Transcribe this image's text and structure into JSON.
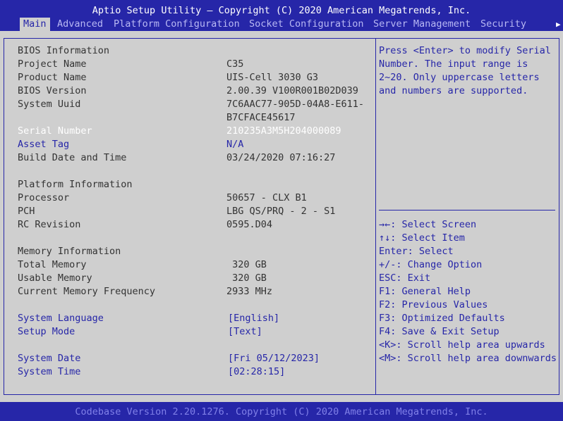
{
  "window": {
    "title": "Aptio Setup Utility – Copyright (C) 2020 American Megatrends, Inc."
  },
  "tabs": [
    {
      "label": "Main"
    },
    {
      "label": "Advanced"
    },
    {
      "label": "Platform Configuration"
    },
    {
      "label": "Socket Configuration"
    },
    {
      "label": "Server Management"
    },
    {
      "label": "Security"
    }
  ],
  "more_tabs_icon": "right-arrow-icon",
  "more_tabs_glyph": "▶",
  "bios": {
    "heading": "BIOS Information",
    "project_name_label": "Project Name",
    "project_name": "C35",
    "product_name_label": "Product Name",
    "product_name": "UIS-Cell 3030 G3",
    "bios_version_label": "BIOS Version",
    "bios_version": "2.00.39 V100R001B02D039",
    "uuid_label": "System Uuid",
    "uuid_line1": "7C6AAC77-905D-04A8-E611-",
    "uuid_line2": "B7CFACE45617",
    "serial_label": "Serial Number",
    "serial": "210235A3M5H204000089",
    "asset_label": "Asset Tag",
    "asset": "N/A",
    "build_label": "Build Date and Time",
    "build": "03/24/2020 07:16:27"
  },
  "platform": {
    "heading": "Platform Information",
    "processor_label": "Processor",
    "processor": "50657 - CLX B1",
    "pch_label": "PCH",
    "pch": "LBG QS/PRQ - 2 - S1",
    "rc_label": "RC Revision",
    "rc": "0595.D04"
  },
  "memory": {
    "heading": "Memory Information",
    "total_label": "Total Memory",
    "total": " 320 GB",
    "usable_label": "Usable Memory",
    "usable": " 320 GB",
    "freq_label": "Current Memory Frequency",
    "freq": "2933 MHz"
  },
  "settings": {
    "language_label": "System Language",
    "language": "[English]",
    "setup_mode_label": "Setup Mode",
    "setup_mode": "[Text]",
    "date_label": "System Date",
    "date": "[Fri 05/12/2023]",
    "time_label": "System Time",
    "time": "[02:28:15]"
  },
  "help": {
    "lines": [
      "Press <Enter> to modify Serial",
      "Number. The input range is",
      "2~20. Only uppercase letters",
      "and numbers are supported."
    ]
  },
  "keys": {
    "lines": [
      "→←: Select Screen",
      "↑↓: Select Item",
      "Enter: Select",
      "+/-: Change Option",
      "ESC: Exit",
      "F1: General Help",
      "F2: Previous Values",
      "F3: Optimized Defaults",
      "F4: Save & Exit Setup",
      "<K>: Scroll help area upwards",
      "<M>: Scroll help area downwards"
    ]
  },
  "footer": {
    "text": "Codebase Version 2.20.1276. Copyright (C) 2020 American Megatrends, Inc."
  },
  "colors": {
    "background": "#2626a8",
    "panel": "#cfcfcf",
    "text": "#333333",
    "highlight": "#ffffff",
    "selectable": "#2626a8"
  }
}
